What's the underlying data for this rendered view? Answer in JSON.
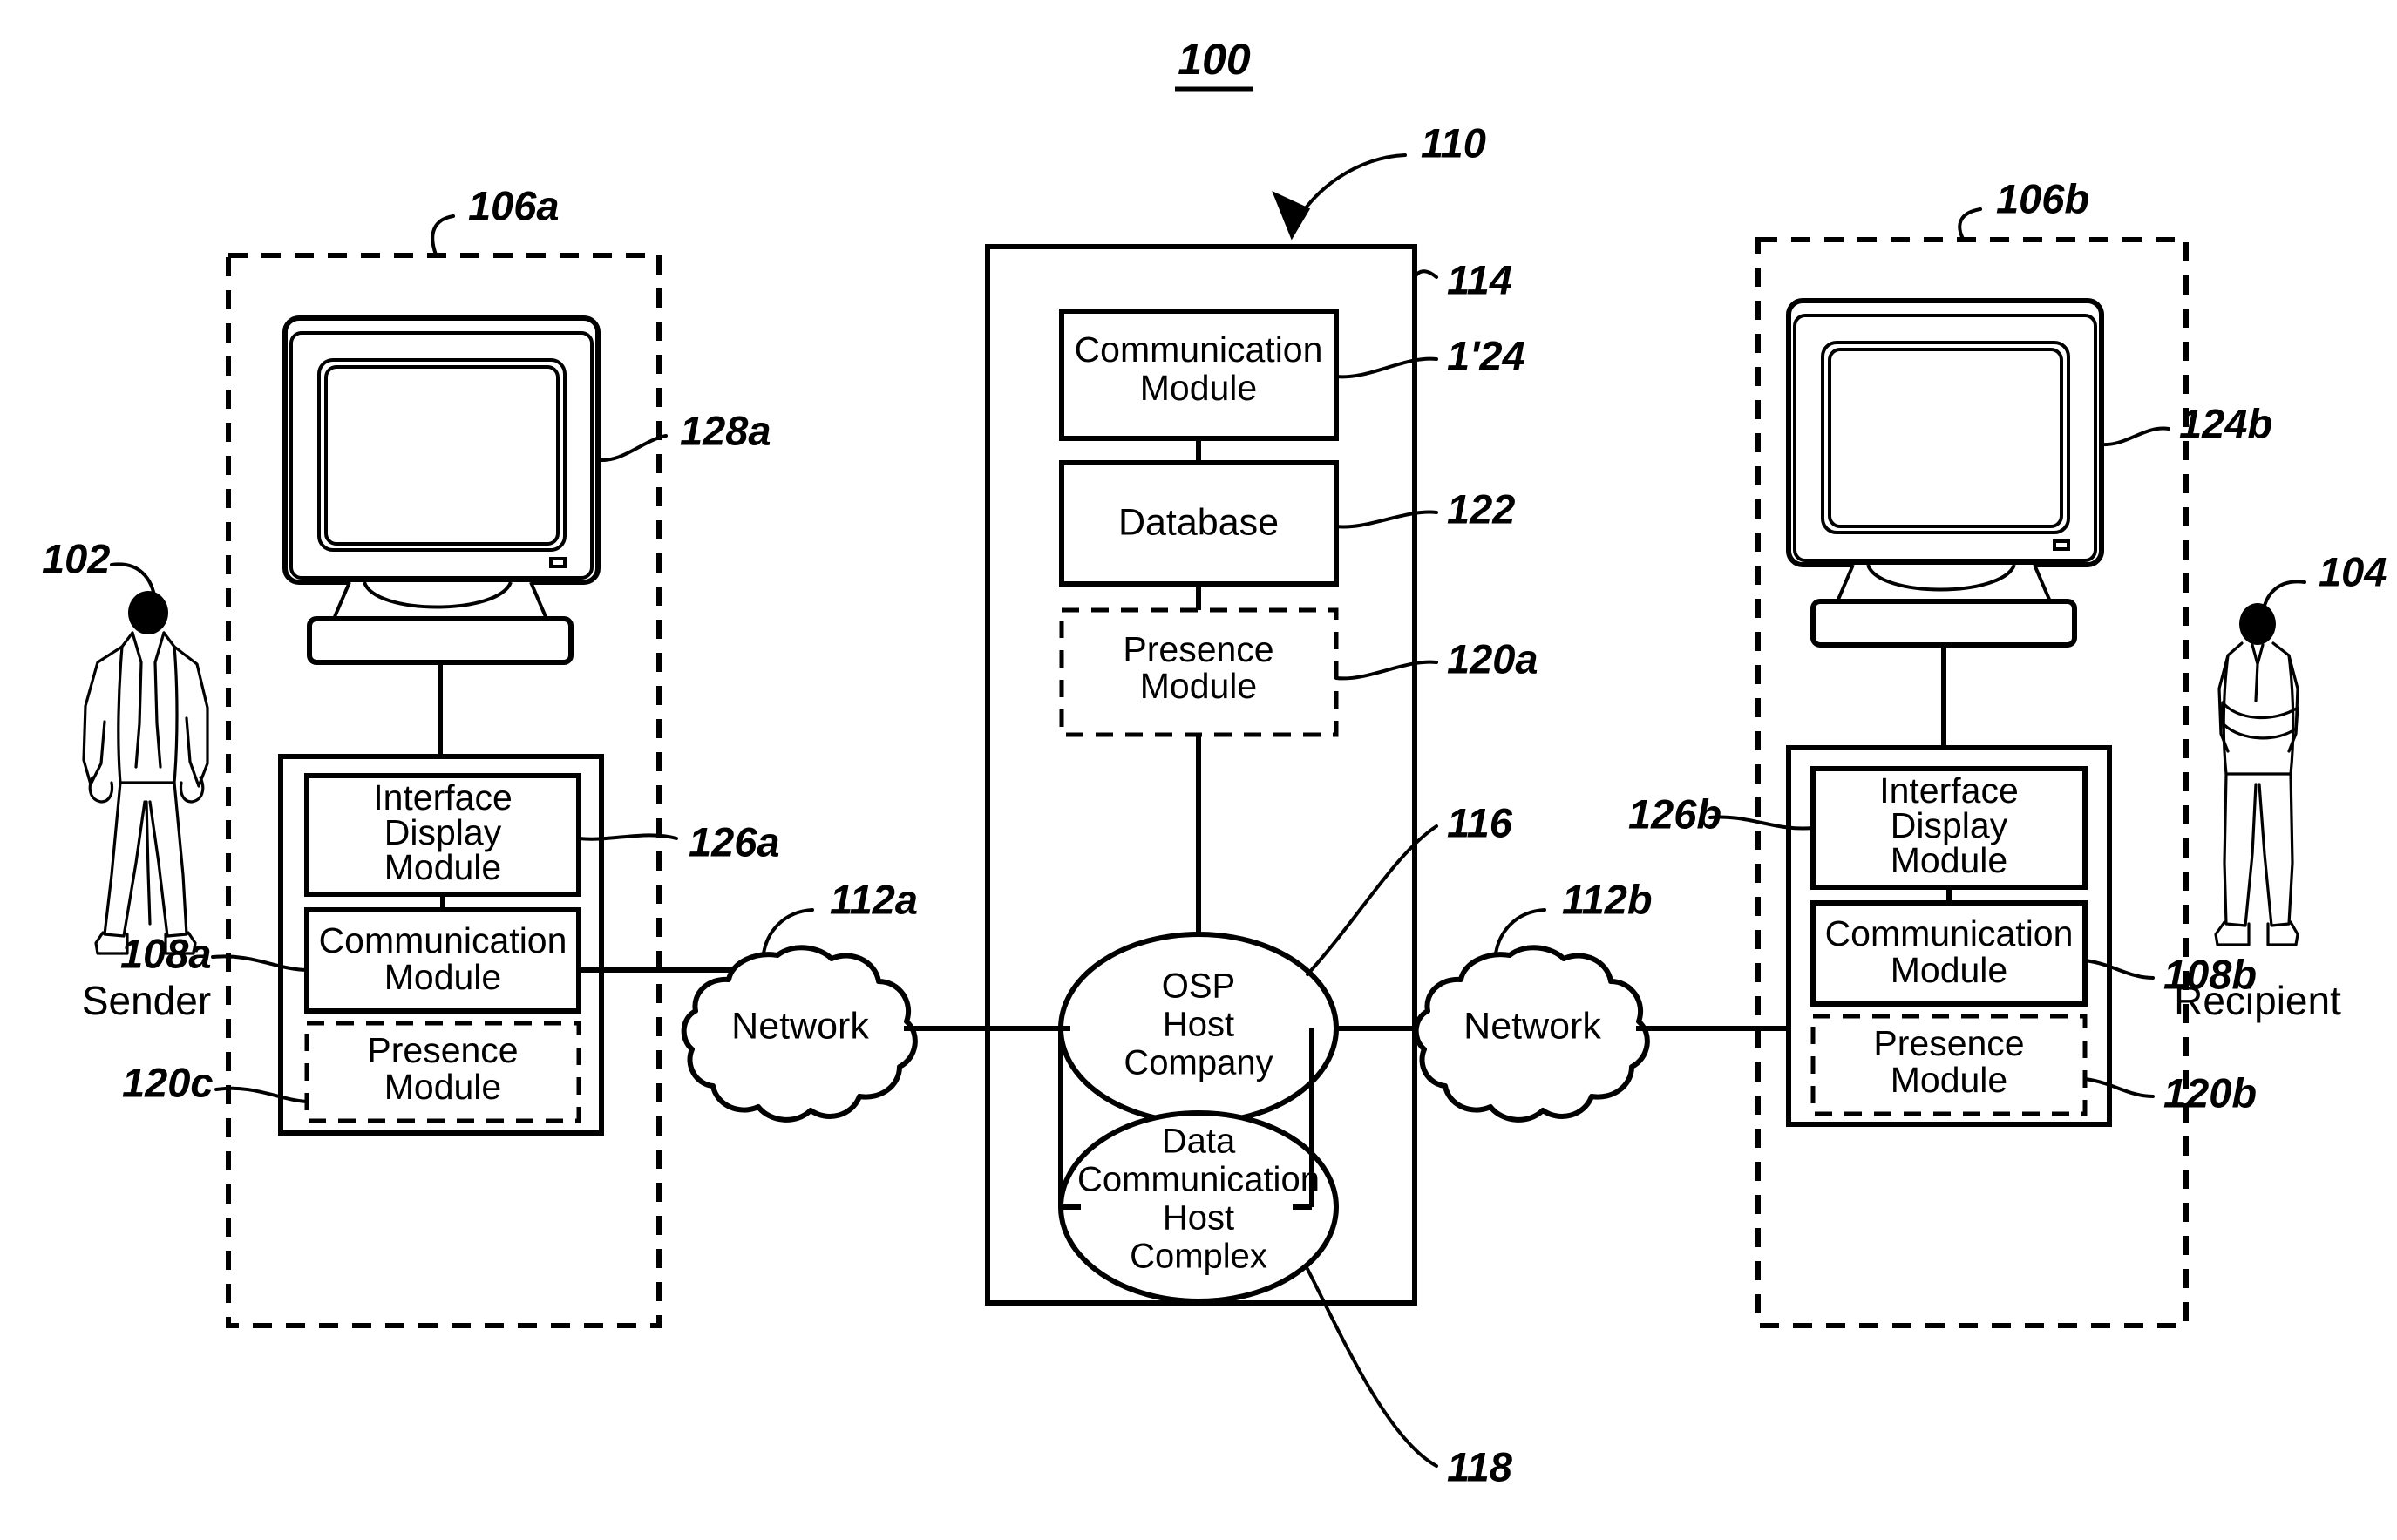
{
  "figure": {
    "number": "100",
    "system_ref": "110"
  },
  "sender": {
    "label": "Sender",
    "ref": "102",
    "device_ref": "106a",
    "monitor_ref": "128a",
    "modules": [
      {
        "name": "Interface Display Module",
        "ref": "126a",
        "style": "solid"
      },
      {
        "name": "Communication Module",
        "ref": "108a",
        "style": "solid"
      },
      {
        "name": "Presence Module",
        "ref": "120c",
        "style": "dashed"
      }
    ]
  },
  "recipient": {
    "label": "Recipient",
    "ref": "104",
    "device_ref": "106b",
    "monitor_ref": "124b",
    "modules": [
      {
        "name": "Interface Display Module",
        "ref": "126b",
        "style": "solid"
      },
      {
        "name": "Communication Module",
        "ref": "108b",
        "style": "solid"
      },
      {
        "name": "Presence Module",
        "ref": "120b",
        "style": "dashed"
      }
    ]
  },
  "networks": [
    {
      "label": "Network",
      "ref": "112a"
    },
    {
      "label": "Network",
      "ref": "112b"
    }
  ],
  "host_complex": {
    "container_ref": "114",
    "modules": [
      {
        "name": "Communication Module",
        "ref": "1'24",
        "style": "solid"
      },
      {
        "name": "Database",
        "ref": "122",
        "style": "solid"
      },
      {
        "name": "Presence Module",
        "ref": "120a",
        "style": "dashed"
      }
    ],
    "nodes": [
      {
        "name": "OSP Host Company",
        "lines": [
          "OSP",
          "Host",
          "Company"
        ],
        "ref": "116"
      },
      {
        "name": "Data Communication Host Complex",
        "lines": [
          "Data",
          "Communication",
          "Host",
          "Complex"
        ],
        "ref": "118"
      }
    ]
  },
  "colors": {
    "ink": "#000000",
    "paper": "#ffffff"
  }
}
